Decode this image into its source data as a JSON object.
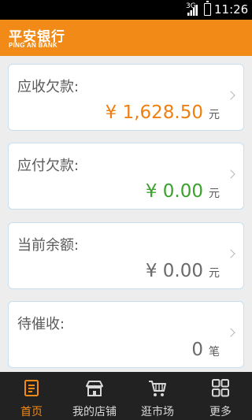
{
  "status_bar": {
    "network": "3G",
    "time": "11:26"
  },
  "header": {
    "logo_cn": "平安银行",
    "logo_en": "PING AN BANK"
  },
  "cards": [
    {
      "label": "应收欠款:",
      "value": "¥ 1,628.50",
      "unit": "元",
      "value_color": "#f07f10"
    },
    {
      "label": "应付欠款:",
      "value": "¥ 0.00",
      "unit": "元",
      "value_color": "#3aa12c"
    },
    {
      "label": "当前余额:",
      "value": "¥ 0.00",
      "unit": "元",
      "value_color": "#6a6a6a"
    },
    {
      "label": "待催收:",
      "value": "0",
      "unit": "笔",
      "value_color": "#6a6a6a"
    }
  ],
  "tabbar": {
    "active_color": "#f28a17",
    "tabs": [
      {
        "label": "首页",
        "icon": "document-icon",
        "active": true
      },
      {
        "label": "我的店铺",
        "icon": "store-icon",
        "active": false
      },
      {
        "label": "逛市场",
        "icon": "cart-icon",
        "active": false
      },
      {
        "label": "更多",
        "icon": "grid-icon",
        "active": false
      }
    ]
  }
}
